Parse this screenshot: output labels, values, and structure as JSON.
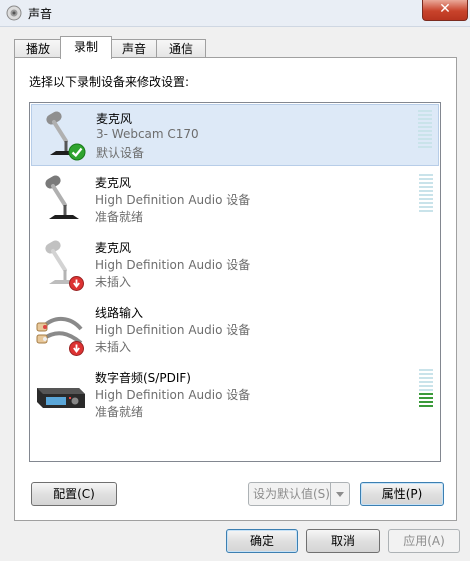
{
  "window": {
    "title": "声音"
  },
  "tabs": [
    {
      "label": "播放"
    },
    {
      "label": "录制"
    },
    {
      "label": "声音"
    },
    {
      "label": "通信"
    }
  ],
  "instruction": "选择以下录制设备来修改设置:",
  "devices": [
    {
      "name": "麦克风",
      "description": "3- Webcam C170",
      "status": "默认设备",
      "icon": "microphone-icon",
      "badge": "default-check-icon",
      "selected": true,
      "level": 0
    },
    {
      "name": "麦克风",
      "description": "High Definition Audio 设备",
      "status": "准备就绪",
      "icon": "microphone-icon",
      "badge": null,
      "selected": false,
      "level": 0
    },
    {
      "name": "麦克风",
      "description": "High Definition Audio 设备",
      "status": "未插入",
      "icon": "microphone-icon",
      "badge": "unplugged-icon",
      "selected": false,
      "level": null
    },
    {
      "name": "线路输入",
      "description": "High Definition Audio 设备",
      "status": "未插入",
      "icon": "line-in-cable-icon",
      "badge": "unplugged-icon",
      "selected": false,
      "level": null
    },
    {
      "name": "数字音频(S/PDIF)",
      "description": "High Definition Audio 设备",
      "status": "准备就绪",
      "icon": "spdif-receiver-icon",
      "badge": null,
      "selected": false,
      "level": 0.4
    }
  ],
  "buttons": {
    "configure": "配置(C)",
    "set_default": "设为默认值(S)",
    "properties": "属性(P)",
    "ok": "确定",
    "cancel": "取消",
    "apply": "应用(A)"
  },
  "colors": {
    "selection": "#dde9f7",
    "meter_on": "#3a9a3a",
    "meter_off": "#c9e3ea",
    "close_button": "#c8432b"
  }
}
